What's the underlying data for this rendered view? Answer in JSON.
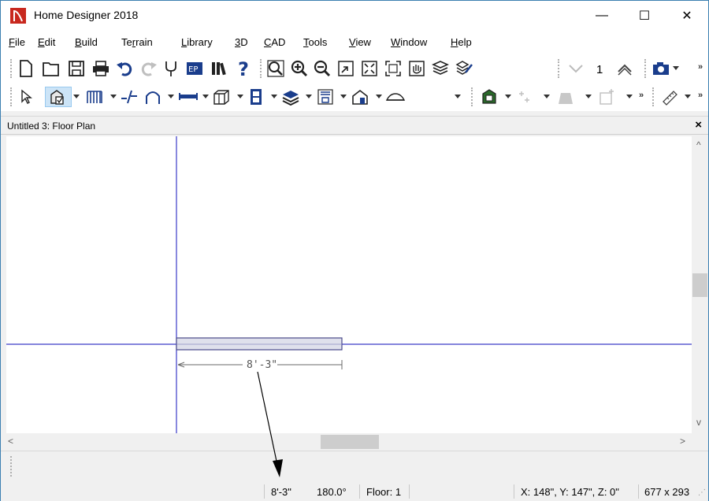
{
  "window": {
    "title": "Home Designer 2018",
    "min_glyph": "—",
    "max_glyph": "☐",
    "close_glyph": "✕"
  },
  "menu": [
    {
      "label": "File",
      "key": "F",
      "rest": "ile"
    },
    {
      "label": "Edit",
      "key": "E",
      "rest": "dit"
    },
    {
      "label": "Build",
      "key": "B",
      "rest": "uild"
    },
    {
      "label": "Terrain",
      "pre": "Te",
      "key": "r",
      "rest": "rain"
    },
    {
      "label": "Library",
      "key": "L",
      "rest": "ibrary"
    },
    {
      "label": "3D",
      "key": "3",
      "rest": "D"
    },
    {
      "label": "CAD",
      "key": "C",
      "rest": "AD"
    },
    {
      "label": "Tools",
      "key": "T",
      "rest": "ools"
    },
    {
      "label": "View",
      "key": "V",
      "rest": "iew"
    },
    {
      "label": "Window",
      "key": "W",
      "rest": "indow"
    },
    {
      "label": "Help",
      "key": "H",
      "rest": "elp"
    }
  ],
  "toolbar1": {
    "icons": [
      "new-file-icon",
      "open-folder-icon",
      "save-icon",
      "print-icon",
      "undo-icon",
      "redo-icon",
      "plugin-icon",
      "page-setup-icon",
      "library-icon",
      "help-icon",
      "zoom-icon",
      "zoom-in-icon",
      "zoom-out-icon",
      "zoom-box-icon",
      "fill-window-icon",
      "fill-window-building-icon",
      "pan-icon",
      "layers-icon",
      "edit-layers-icon",
      "floor-down-icon",
      "floor-up-icon",
      "camera-icon"
    ],
    "current_floor": "1",
    "overflow": "»"
  },
  "toolbar2": {
    "icons": [
      "select-arrow-icon",
      "select-objects-icon",
      "wall-tool-icon",
      "break-wall-icon",
      "arch-tool-icon",
      "railing-icon",
      "cabinet-icon",
      "window-tool-icon",
      "stairs-tool-icon",
      "room-tool-icon",
      "roof-tool-icon",
      "terrain-icon",
      "text-tool-icon",
      "symbol-icon",
      "camera-view-icon",
      "fixture-icon",
      "dimension-tool-icon"
    ],
    "overflow": "»"
  },
  "document": {
    "title": "Untitled 3: Floor Plan",
    "close_glyph": "×"
  },
  "plan": {
    "wall_length_label": "8'-3\""
  },
  "scroll": {
    "up": "^",
    "down": "v",
    "left": "<",
    "right": ">"
  },
  "status": {
    "length": "8'-3\"",
    "angle": "180.0°",
    "floor": "Floor: 1",
    "coordinates": "X: 148\", Y: 147\", Z: 0\"",
    "view_size": "677 x 293"
  },
  "colors": {
    "app_icon": "#c8281e",
    "crosshair": "#3a3ac8",
    "wall_fill": "#dfe0ec",
    "wall_stroke": "#4a4a8a",
    "dimension": "#6a6a6a"
  }
}
